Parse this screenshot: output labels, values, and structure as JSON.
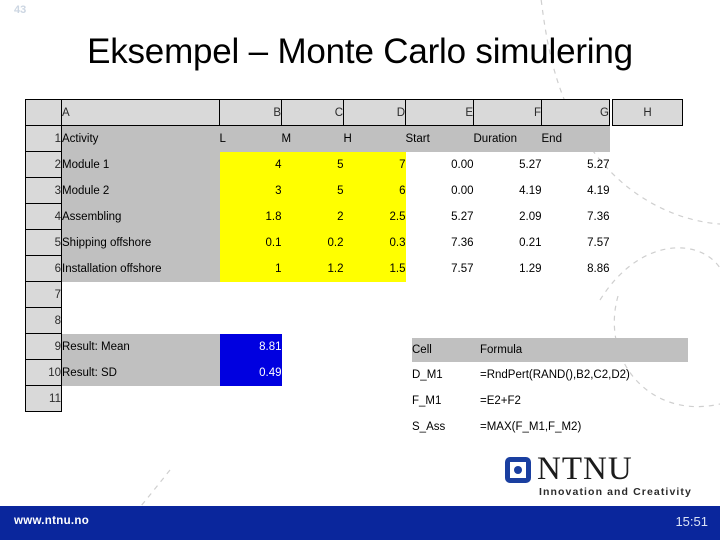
{
  "slide": {
    "number": "43",
    "title": "Eksempel – Monte Carlo simulering"
  },
  "spreadsheet": {
    "column_headers": [
      "A",
      "B",
      "C",
      "D",
      "E",
      "F",
      "G",
      "H"
    ],
    "row_numbers": [
      "1",
      "2",
      "3",
      "4",
      "5",
      "6",
      "7",
      "8",
      "9",
      "10",
      "11"
    ],
    "header_row": {
      "a": "Activity",
      "b": "L",
      "c": "M",
      "d": "H",
      "e": "Start",
      "f": "Duration",
      "g": "End"
    },
    "rows": [
      {
        "a": "Module 1",
        "b": "4",
        "c": "5",
        "d": "7",
        "e": "0.00",
        "f": "5.27",
        "g": "5.27"
      },
      {
        "a": "Module 2",
        "b": "3",
        "c": "5",
        "d": "6",
        "e": "0.00",
        "f": "4.19",
        "g": "4.19"
      },
      {
        "a": "Assembling",
        "b": "1.8",
        "c": "2",
        "d": "2.5",
        "e": "5.27",
        "f": "2.09",
        "g": "7.36"
      },
      {
        "a": "Shipping offshore",
        "b": "0.1",
        "c": "0.2",
        "d": "0.3",
        "e": "7.36",
        "f": "0.21",
        "g": "7.57"
      },
      {
        "a": "Installation offshore",
        "b": "1",
        "c": "1.2",
        "d": "1.5",
        "e": "7.57",
        "f": "1.29",
        "g": "8.86"
      }
    ],
    "results": [
      {
        "label": "Result: Mean",
        "value": "8.81"
      },
      {
        "label": "Result: SD",
        "value": "0.49"
      }
    ]
  },
  "formulas": {
    "header": {
      "cell": "Cell",
      "formula": "Formula"
    },
    "rows": [
      {
        "cell": "D_M1",
        "formula": "=RndPert(RAND(),B2,C2,D2)"
      },
      {
        "cell": "F_M1",
        "formula": "=E2+F2"
      },
      {
        "cell": "S_Ass",
        "formula": "=MAX(F_M1,F_M2)"
      }
    ]
  },
  "logo": {
    "wordmark": "NTNU",
    "tagline": "Innovation and Creativity"
  },
  "footer": {
    "url": "www.ntnu.no",
    "time": "15:51"
  },
  "colors": {
    "input_highlight": "#ffff00",
    "result_highlight": "#0000e0",
    "label_fill": "#c0c0c0",
    "header_fill": "#d9d9d9",
    "footer_bar": "#0a269c",
    "logo_blue": "#1a3fa0"
  }
}
